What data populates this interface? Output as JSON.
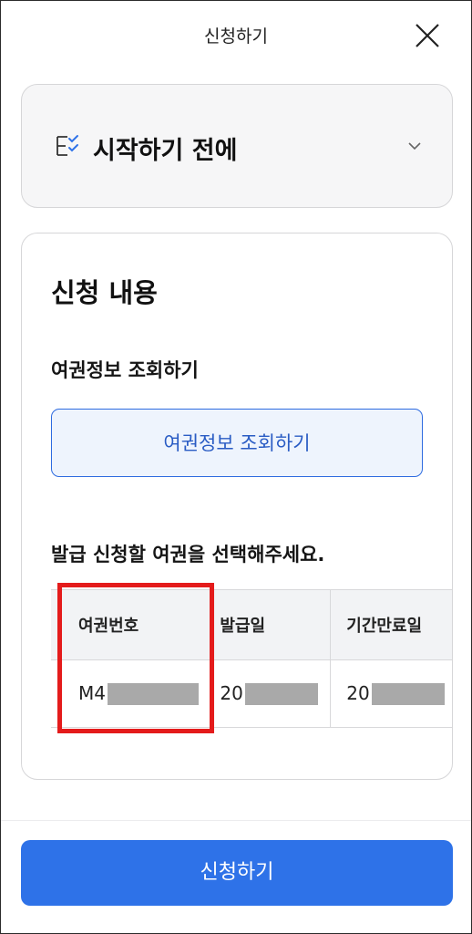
{
  "header": {
    "title": "신청하기",
    "close_icon": "close-icon"
  },
  "accordion": {
    "title": "시작하기 전에",
    "icon": "checklist-icon",
    "chevron": "chevron-down-icon"
  },
  "card": {
    "title": "신청 내용",
    "lookup_label": "여권정보 조회하기",
    "lookup_button": "여권정보 조회하기",
    "select_label": "발급 신청할 여권을 선택해주세요.",
    "table": {
      "headers": [
        "여권번호",
        "발급일",
        "기간만료일"
      ],
      "rows": [
        {
          "passport_no": "M4",
          "issue_date": "20",
          "expiry_date": "20"
        }
      ]
    }
  },
  "footer": {
    "submit_button": "신청하기"
  },
  "colors": {
    "primary": "#2e72e8",
    "highlight": "#e41b1b",
    "masked": "#a9a9a9"
  }
}
